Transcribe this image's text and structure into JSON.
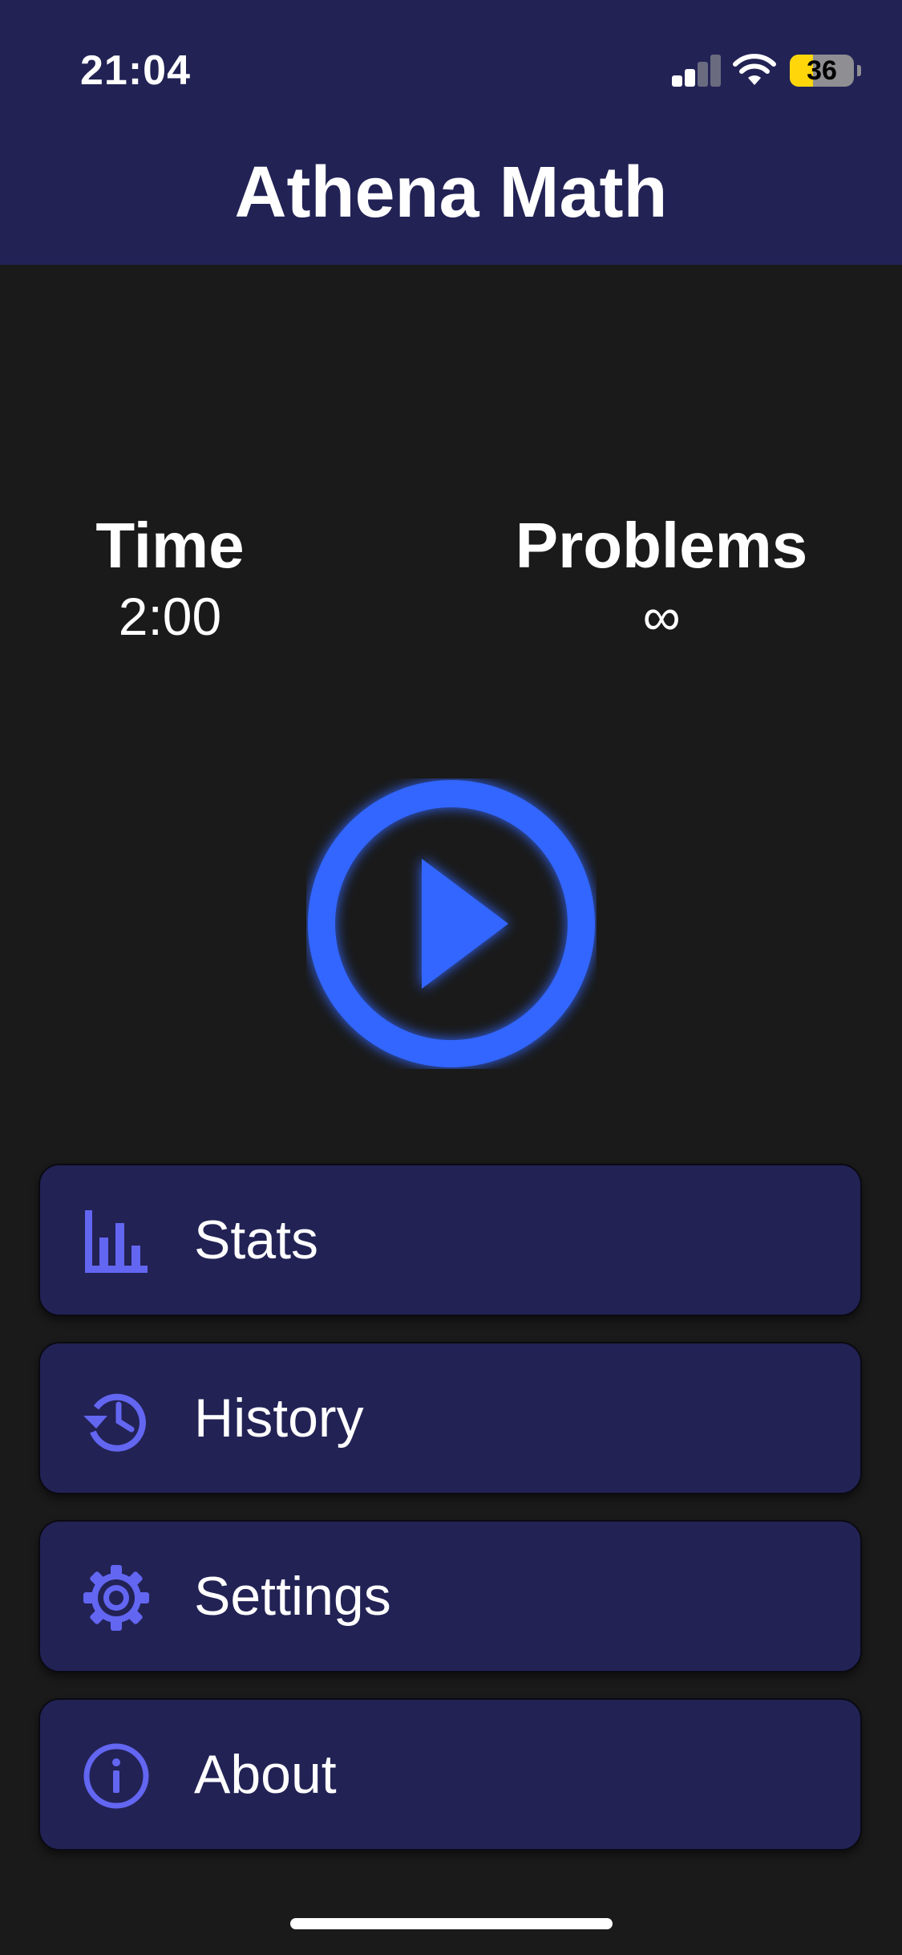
{
  "status_bar": {
    "time": "21:04",
    "battery_level": "36",
    "signal_icon": "cellular-signal-icon",
    "wifi_icon": "wifi-icon",
    "battery_color": "#ffd60a"
  },
  "header": {
    "title": "Athena Math",
    "background": "#222255"
  },
  "settings_summary": {
    "time_label": "Time",
    "time_value": "2:00",
    "problems_label": "Problems",
    "problems_value": "∞"
  },
  "play_button": {
    "icon": "play-circle-icon",
    "color": "#3366ff"
  },
  "menu": [
    {
      "label": "Stats",
      "icon": "bar-chart-icon"
    },
    {
      "label": "History",
      "icon": "history-icon"
    },
    {
      "label": "Settings",
      "icon": "gear-icon"
    },
    {
      "label": "About",
      "icon": "info-icon"
    }
  ],
  "colors": {
    "accent": "#6366f1",
    "button_background": "#222255",
    "page_background": "#1a1a1a"
  }
}
